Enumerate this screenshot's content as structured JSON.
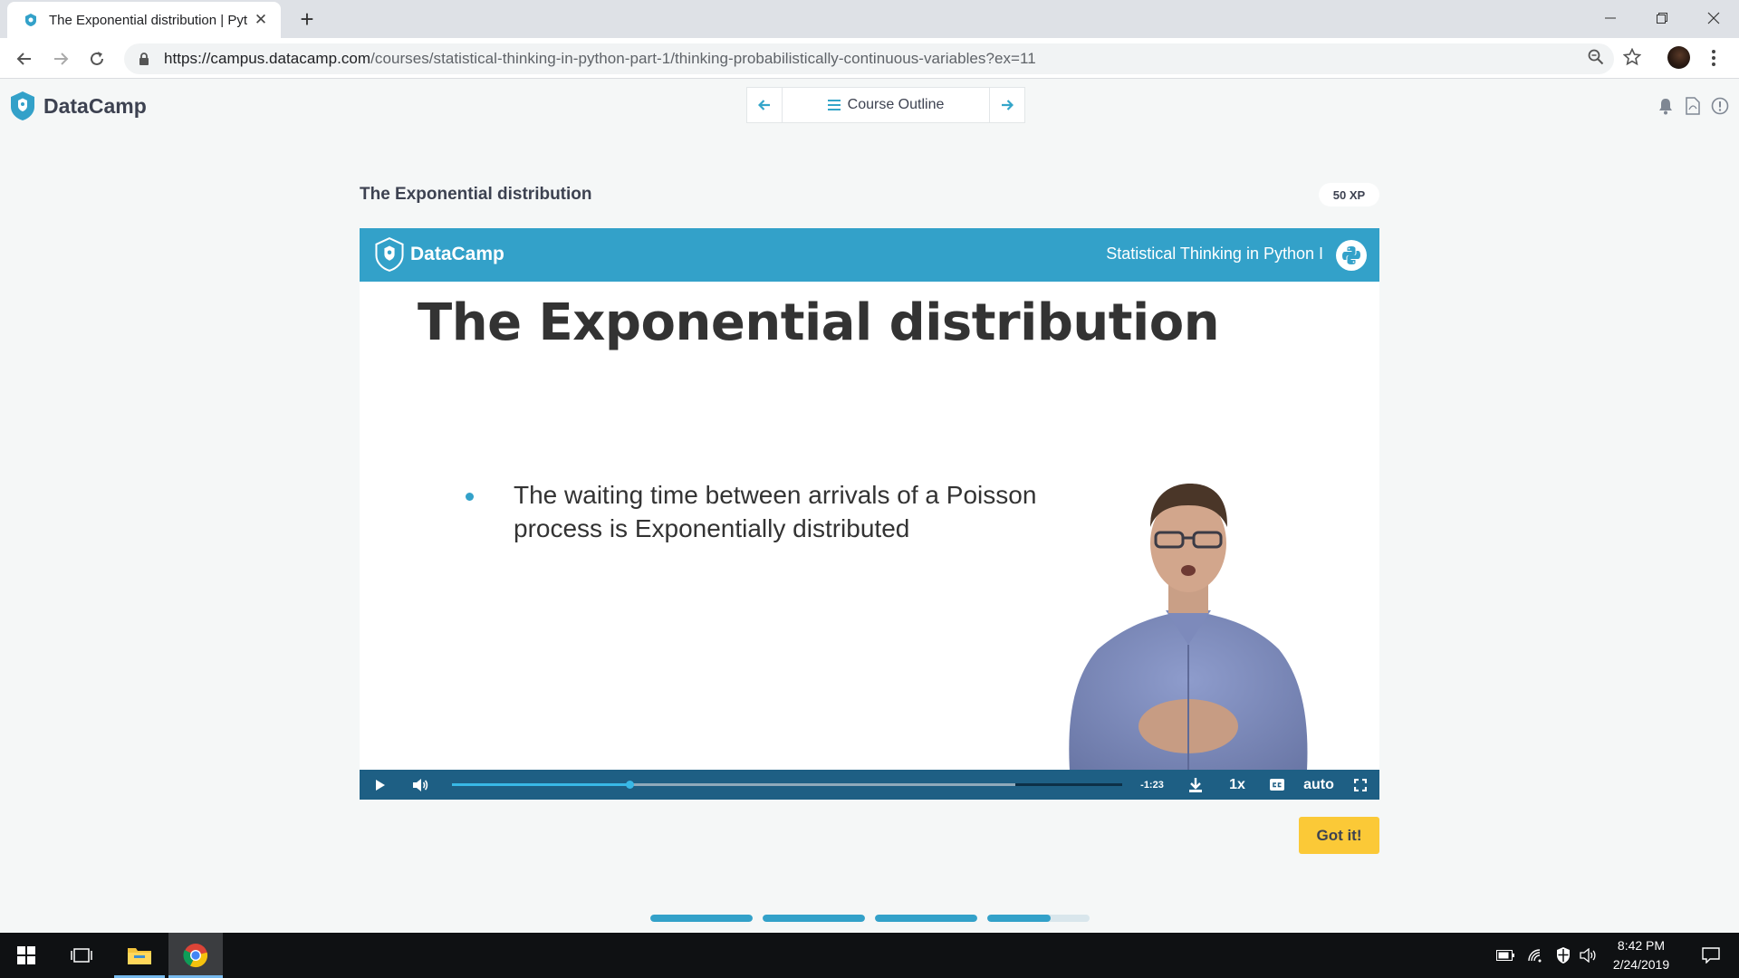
{
  "browser": {
    "tab_title": "The Exponential distribution | Pyt",
    "url_host": "https://campus.datacamp.com",
    "url_path": "/courses/statistical-thinking-in-python-part-1/thinking-probabilistically-continuous-variables?ex=11",
    "tab_close": "✕",
    "new_tab": "+"
  },
  "header": {
    "logo_text": "DataCamp",
    "course_outline_label": "Course Outline"
  },
  "exercise": {
    "title": "The Exponential distribution",
    "xp_badge": "50 XP",
    "got_it_label": "Got it!"
  },
  "video": {
    "banner_logo": "DataCamp",
    "banner_course": "Statistical Thinking in Python I",
    "slide_title": "The Exponential distribution",
    "bullet": "The waiting time between arrivals of a Poisson process is Exponentially distributed",
    "time_remaining": "-1:23",
    "speed": "1x",
    "quality": "auto",
    "played_fraction": 0.265,
    "buffered_fraction": 0.84
  },
  "progress_segments": [
    1,
    1,
    1,
    0.62
  ],
  "taskbar": {
    "time": "8:42 PM",
    "date": "2/24/2019"
  },
  "colors": {
    "brand_blue": "#33a1c9",
    "controls_bg": "#1e5f84",
    "got_it": "#fbc937"
  }
}
